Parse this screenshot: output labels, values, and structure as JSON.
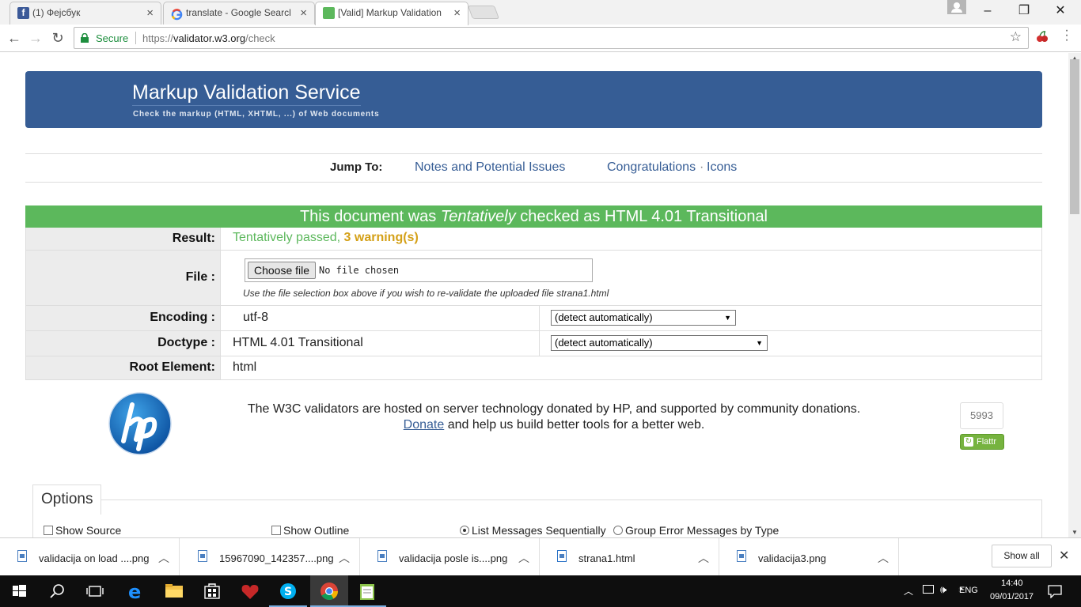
{
  "browser": {
    "tabs": [
      {
        "title": "(1) Фејсбук",
        "favicon_color": "#3b5998"
      },
      {
        "title": "translate - Google Search",
        "favicon_color": "#ffffff"
      },
      {
        "title": "[Valid] Markup Validation Service",
        "favicon_color": "#5cb85c"
      }
    ],
    "secure_label": "Secure",
    "url_protocol": "https://",
    "url_host": "validator.w3.org",
    "url_path": "/check"
  },
  "page": {
    "banner_title": "Markup Validation Service",
    "banner_subtitle": "Check the markup (HTML, XHTML, ...) of Web documents",
    "jump_label": "Jump To:",
    "jump_links": [
      "Notes and Potential Issues",
      "Congratulations",
      "Icons"
    ],
    "jump_separator": "·",
    "result_header_pre": "This document was ",
    "result_header_em": "Tentatively",
    "result_header_post": " checked as HTML 4.01 Transitional",
    "rows": {
      "result_label": "Result:",
      "result_passed": "Tentatively passed, ",
      "result_warnings": "3 warning(s)",
      "file_label": "File :",
      "choose_file": "Choose file",
      "no_file": "No file chosen",
      "file_help": "Use the file selection box above if you wish to re-validate the uploaded file strana1.html",
      "encoding_label": "Encoding :",
      "encoding_value": "utf-8",
      "encoding_select": "(detect automatically)",
      "doctype_label": "Doctype :",
      "doctype_value": "HTML 4.01 Transitional",
      "doctype_select": "(detect automatically)",
      "root_label": "Root Element:",
      "root_value": "html"
    },
    "donation_line1": "The W3C validators are hosted on server technology donated by HP, and supported by community donations.",
    "donate_link": "Donate",
    "donation_line2": " and help us build better tools for a better web.",
    "flattr_count": "5993",
    "flattr_label": "Flattr",
    "options_title": "Options",
    "options": {
      "show_source": "Show Source",
      "show_outline": "Show Outline",
      "list_sequential": "List Messages Sequentially",
      "group_by_type": "Group Error Messages by Type"
    }
  },
  "downloads": [
    "validacija on load ....png",
    "15967090_142357....png",
    "validacija posle is....png",
    "strana1.html",
    "validacija3.png"
  ],
  "show_all": "Show all",
  "taskbar": {
    "language": "ENG",
    "time": "14:40",
    "date": "09/01/2017"
  },
  "colors": {
    "banner": "#365d95",
    "result_green": "#5cb85c",
    "warning": "#d4a017"
  }
}
